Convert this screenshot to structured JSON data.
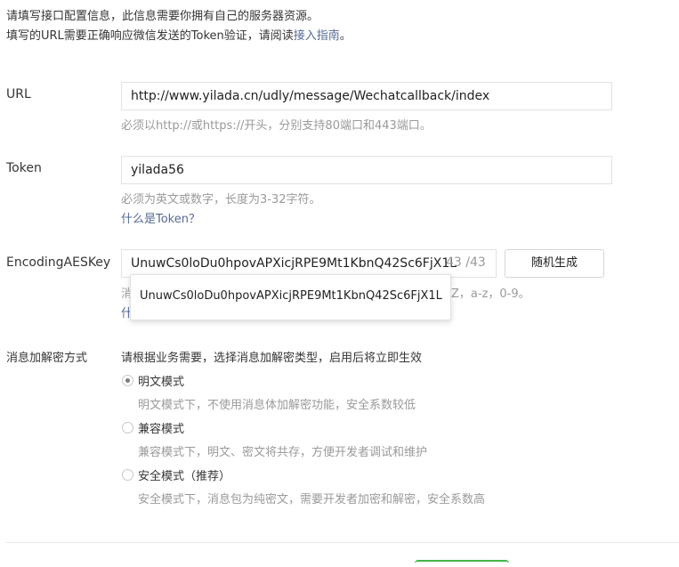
{
  "intro": {
    "line1": "请填写接口配置信息，此信息需要你拥有自己的服务器资源。",
    "line2_prefix": "填写的URL需要正确响应微信发送的Token验证，请阅读",
    "line2_link": "接入指南",
    "line2_suffix": "。"
  },
  "url": {
    "label": "URL",
    "value": "http://www.yilada.cn/udly/message/Wechatcallback/index",
    "tip": "必须以http://或https://开头，分别支持80端口和443端口。"
  },
  "token": {
    "label": "Token",
    "value": "yilada56",
    "tip": "必须为英文或数字，长度为3-32字符。",
    "help_link": "什么是Token？"
  },
  "aeskey": {
    "label": "EncodingAESKey",
    "value": "UnuwCs0loDu0hpovAPXicjRPE9Mt1KbnQ42Sc6FjX1L",
    "counter": "43 /43",
    "random_button": "随机生成",
    "tip_first_char": "消",
    "tip_tail": "Z，a-z，0-9。",
    "help_first_char": "什",
    "autocomplete_item": "UnuwCs0loDu0hpovAPXicjRPE9Mt1KbnQ42Sc6FjX1L"
  },
  "encryption": {
    "label": "消息加解密方式",
    "intro": "请根据业务需要，选择消息加解密类型，启用后将立即生效",
    "options": [
      {
        "label": "明文模式",
        "desc": "明文模式下，不使用消息体加解密功能，安全系数较低",
        "checked": true
      },
      {
        "label": "兼容模式",
        "desc": "兼容模式下，明文、密文将共存，方便开发者调试和维护",
        "checked": false
      },
      {
        "label": "安全模式（推荐）",
        "desc": "安全模式下，消息包为纯密文，需要开发者加密和解密，安全系数高",
        "checked": false
      }
    ]
  }
}
